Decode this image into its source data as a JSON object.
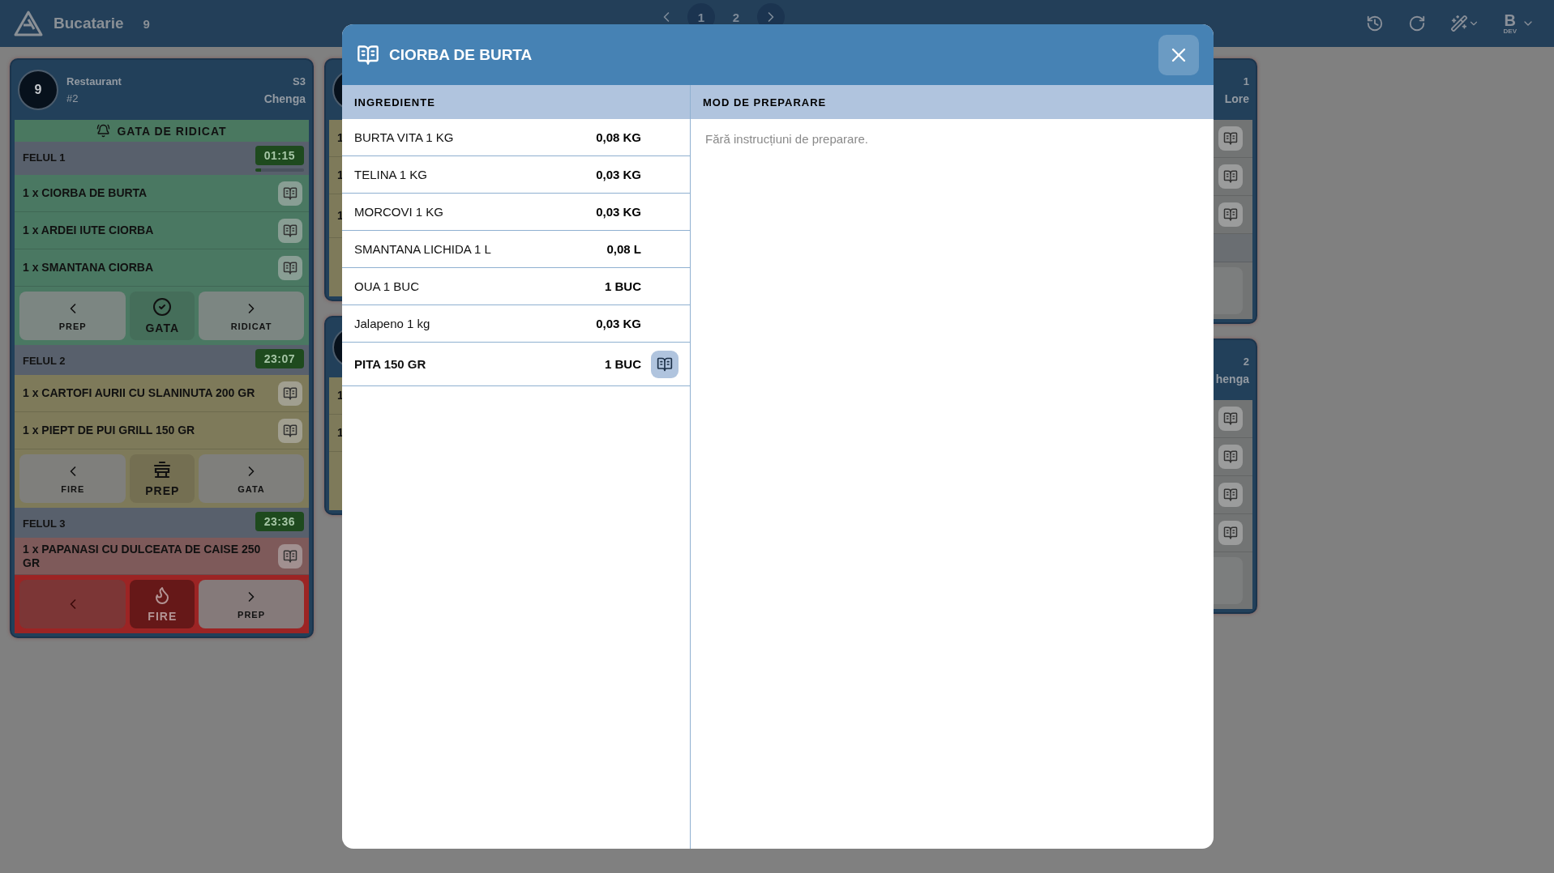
{
  "topbar": {
    "title": "Bucatarie",
    "count": "9",
    "pages": [
      {
        "label": "1",
        "selected": true
      },
      {
        "label": "2",
        "selected": false
      }
    ],
    "user": {
      "initial": "B",
      "tag": "DEV"
    }
  },
  "columns": [
    {
      "kind": "full",
      "cards": [
        {
          "table": "9",
          "venue": "Restaurant",
          "order": "#2",
          "seat": "S3",
          "waiter": "Chenga",
          "banner": "GATA DE RIDICAT",
          "courses": [
            {
              "title": "FELUL 1",
              "timer": "01:15",
              "level": 0.12,
              "kind": "ready",
              "items": [
                "1 x CIORBA DE BURTA",
                "1 x ARDEI IUTE CIORBA",
                "1 x SMANTANA CIORBA"
              ],
              "actions": [
                {
                  "kind": "back",
                  "label": "PREP"
                },
                {
                  "kind": "current",
                  "label": "GATA"
                },
                {
                  "kind": "next",
                  "label": "RIDICAT"
                }
              ]
            },
            {
              "title": "FELUL 2",
              "timer": "23:07",
              "kind": "prep",
              "items": [
                "1 x CARTOFI AURII CU SLANINUTA 200 GR",
                "1 x PIEPT DE PUI GRILL 150 GR"
              ],
              "actions": [
                {
                  "kind": "back",
                  "label": "FIRE"
                },
                {
                  "kind": "current",
                  "label": "PREP"
                },
                {
                  "kind": "next",
                  "label": "GATA"
                }
              ]
            },
            {
              "title": "FELUL 3",
              "timer": "23:36",
              "kind": "fire",
              "items": [
                "1 x PAPANASI CU DULCEATA DE CAISE 250 GR"
              ],
              "actions": [
                {
                  "kind": "back"
                },
                {
                  "kind": "current",
                  "label": "FIRE"
                },
                {
                  "kind": "next",
                  "label": "PREP"
                }
              ]
            }
          ]
        }
      ]
    },
    {
      "kind": "left_edge",
      "cards": [
        {
          "kind": "prep",
          "rows": [
            {
              "kind": "single",
              "text": "1"
            },
            {
              "kind": "single",
              "text": "1"
            },
            {
              "kind": "tall",
              "text": "1"
            }
          ]
        },
        {
          "kind": "prep",
          "rows": [
            {
              "kind": "single",
              "text": "1"
            },
            {
              "kind": "single",
              "text": "1"
            }
          ]
        }
      ]
    },
    {
      "kind": "right_edge",
      "cards": [
        {
          "number": "1",
          "waiter": "Lore",
          "rows": [
            {
              "kind": "item"
            },
            {
              "kind": "item"
            },
            {
              "kind": "item"
            },
            {
              "kind": "course"
            }
          ]
        },
        {
          "number": "2",
          "waiter": "henga",
          "rows": [
            {
              "kind": "item"
            },
            {
              "kind": "item"
            },
            {
              "kind": "item"
            },
            {
              "kind": "item"
            }
          ]
        }
      ]
    }
  ],
  "modal": {
    "title": "CIORBA DE BURTA",
    "ingredients_heading": "INGREDIENTE",
    "method_heading": "MOD DE PREPARARE",
    "ingredients": [
      {
        "name": "BURTA VITA 1 KG",
        "quantity": "0,08 KG",
        "has_recipe": false
      },
      {
        "name": "TELINA 1 KG",
        "quantity": "0,03 KG",
        "has_recipe": false
      },
      {
        "name": "MORCOVI 1 KG",
        "quantity": "0,03 KG",
        "has_recipe": false
      },
      {
        "name": "SMANTANA LICHIDA 1 L",
        "quantity": "0,08 L",
        "has_recipe": false
      },
      {
        "name": "OUA 1 BUC",
        "quantity": "1 BUC",
        "has_recipe": false
      },
      {
        "name": "Jalapeno 1 kg",
        "quantity": "0,03 KG",
        "has_recipe": false
      },
      {
        "name": "PITA 150 GR",
        "quantity": "1 BUC",
        "has_recipe": true
      }
    ],
    "method": "Fără instrucțiuni de preparare."
  }
}
